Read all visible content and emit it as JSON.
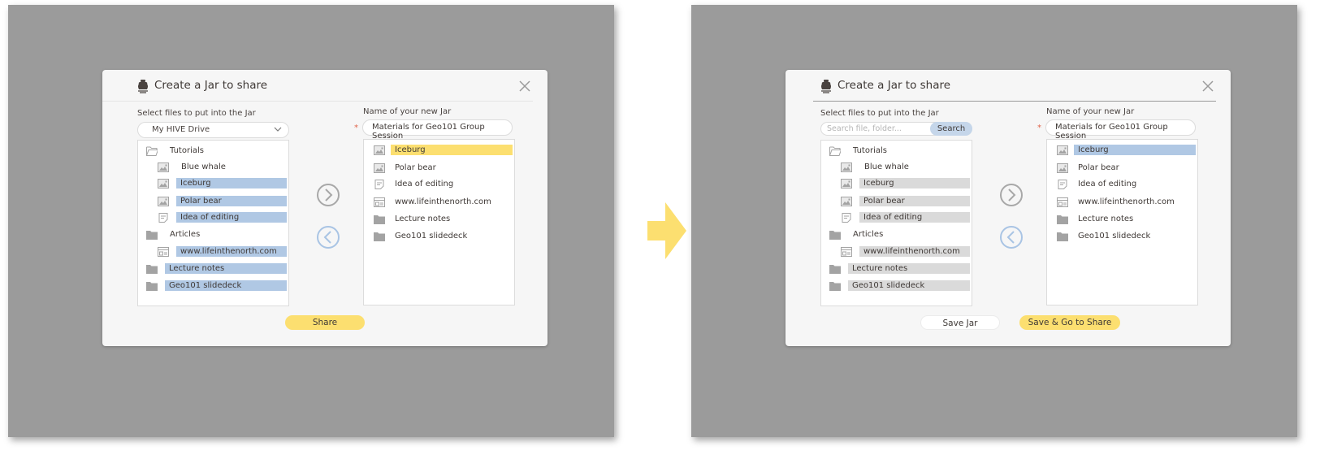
{
  "colors": {
    "accent_yellow": "#fcdf70",
    "selection_blue": "#b0c8e4",
    "selection_gray": "#dadada",
    "backdrop_gray": "#9b9b9b",
    "required_red": "#e0634a"
  },
  "transition_arrow": {
    "icon": "right-arrow-icon"
  },
  "before": {
    "dialog": {
      "title": "Create a Jar to share",
      "title_icon": "jar-icon",
      "close_icon": "close-icon",
      "left_label": "Select files to put into the Jar",
      "source_select": {
        "value": "My HIVE Drive",
        "icon": "chevron-down-icon"
      },
      "right_label": "Name of your new Jar",
      "required_marker": "*",
      "jar_name": "Materials for Geo101 Group Session",
      "source_tree": [
        {
          "label": "Tutorials",
          "icon": "folder-open-icon",
          "level": 0,
          "selected": false
        },
        {
          "label": "Blue whale",
          "icon": "image-icon",
          "level": 1,
          "selected": false
        },
        {
          "label": "Iceburg",
          "icon": "image-icon",
          "level": 1,
          "selected": true
        },
        {
          "label": "Polar bear",
          "icon": "image-icon",
          "level": 1,
          "selected": true
        },
        {
          "label": "Idea of editing",
          "icon": "note-icon",
          "level": 1,
          "selected": true
        },
        {
          "label": "Articles",
          "icon": "folder-icon",
          "level": 0,
          "selected": false
        },
        {
          "label": "www.lifeinthenorth.com",
          "icon": "webpage-icon",
          "level": 1,
          "selected": true
        },
        {
          "label": "Lecture notes",
          "icon": "folder-icon",
          "level": 0,
          "selected": true
        },
        {
          "label": "Geo101 slidedeck",
          "icon": "folder-icon",
          "level": 0,
          "selected": true
        }
      ],
      "jar_contents": [
        {
          "label": "Iceburg",
          "icon": "image-icon",
          "highlighted": true
        },
        {
          "label": "Polar bear",
          "icon": "image-icon",
          "highlighted": false
        },
        {
          "label": "Idea of editing",
          "icon": "note-icon",
          "highlighted": false
        },
        {
          "label": "www.lifeinthenorth.com",
          "icon": "webpage-icon",
          "highlighted": false
        },
        {
          "label": "Lecture notes",
          "icon": "folder-icon",
          "highlighted": false
        },
        {
          "label": "Geo101 slidedeck",
          "icon": "folder-icon",
          "highlighted": false
        }
      ],
      "add_button_icon": "chevron-right-circle-icon",
      "remove_button_icon": "chevron-left-circle-icon",
      "share_label": "Share"
    }
  },
  "after": {
    "dialog": {
      "title": "Create a Jar to share",
      "title_icon": "jar-icon",
      "close_icon": "close-icon",
      "left_label": "Select files to put into the Jar",
      "search": {
        "placeholder": "Search file, folder...",
        "value": "",
        "button_label": "Search"
      },
      "right_label": "Name of your new Jar",
      "required_marker": "*",
      "jar_name": "Materials for Geo101 Group Session",
      "source_tree": [
        {
          "label": "Tutorials",
          "icon": "folder-open-icon",
          "level": 0,
          "selected": false
        },
        {
          "label": "Blue whale",
          "icon": "image-icon",
          "level": 1,
          "selected": false
        },
        {
          "label": "Iceburg",
          "icon": "image-icon",
          "level": 1,
          "selected": true
        },
        {
          "label": "Polar bear",
          "icon": "image-icon",
          "level": 1,
          "selected": true
        },
        {
          "label": "Idea of editing",
          "icon": "note-icon",
          "level": 1,
          "selected": true
        },
        {
          "label": "Articles",
          "icon": "folder-icon",
          "level": 0,
          "selected": false
        },
        {
          "label": "www.lifeinthenorth.com",
          "icon": "webpage-icon",
          "level": 1,
          "selected": true
        },
        {
          "label": "Lecture notes",
          "icon": "folder-icon",
          "level": 0,
          "selected": true
        },
        {
          "label": "Geo101 slidedeck",
          "icon": "folder-icon",
          "level": 0,
          "selected": true
        }
      ],
      "jar_contents": [
        {
          "label": "Iceburg",
          "icon": "image-icon",
          "highlighted": true
        },
        {
          "label": "Polar bear",
          "icon": "image-icon",
          "highlighted": false
        },
        {
          "label": "Idea of editing",
          "icon": "note-icon",
          "highlighted": false
        },
        {
          "label": "www.lifeinthenorth.com",
          "icon": "webpage-icon",
          "highlighted": false
        },
        {
          "label": "Lecture notes",
          "icon": "folder-icon",
          "highlighted": false
        },
        {
          "label": "Geo101 slidedeck",
          "icon": "folder-icon",
          "highlighted": false
        }
      ],
      "add_button_icon": "chevron-right-circle-icon",
      "remove_button_icon": "chevron-left-circle-icon",
      "save_jar_label": "Save Jar",
      "save_go_label": "Save & Go to Share"
    }
  }
}
